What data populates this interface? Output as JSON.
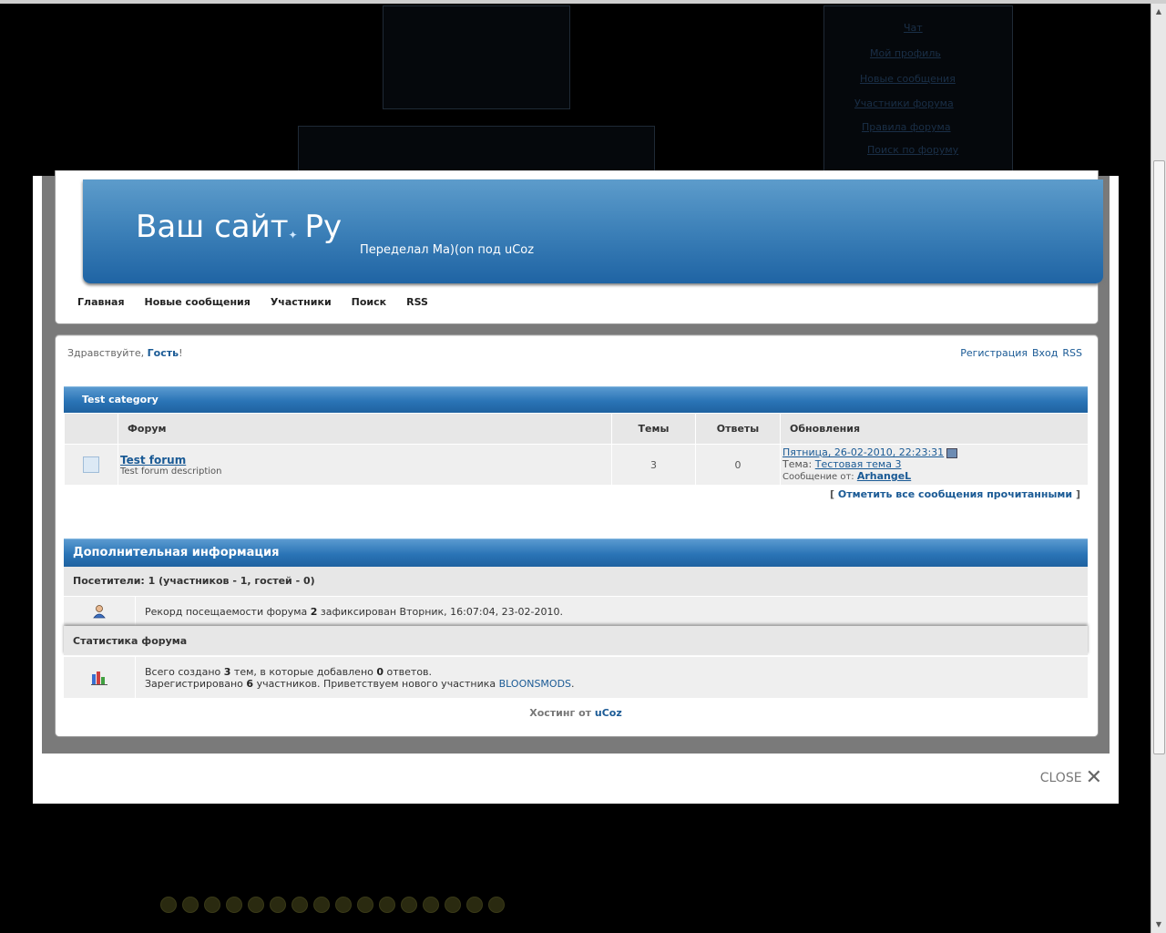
{
  "background": {
    "links": [
      "Чат",
      "Мой профиль",
      "Новые сообщения",
      "Участники форума",
      "Правила форума",
      "Поиск по форуму"
    ]
  },
  "site": {
    "title_part1": "Ваш сайт",
    "title_part2": "Ру",
    "slogan": "Переделал Ma)(on под uCoz"
  },
  "nav": [
    "Главная",
    "Новые сообщения",
    "Участники",
    "Поиск",
    "RSS"
  ],
  "greeting": {
    "prefix": "Здравствуйте,",
    "user": "Гость",
    "suffix": "!"
  },
  "top_links": [
    "Регистрация",
    "Вход",
    "RSS"
  ],
  "category": {
    "title": "Test category",
    "columns": [
      "Форум",
      "Темы",
      "Ответы",
      "Обновления"
    ],
    "forums": [
      {
        "name": "Test forum",
        "description": "Test forum description",
        "topics": "3",
        "replies": "0",
        "last_date": "Пятница, 26-02-2010, 22:23:31",
        "topic_label": "Тема:",
        "topic_title": "Тестовая тема 3",
        "author_label": "Сообщение от:",
        "author": "ArhangeL"
      }
    ]
  },
  "mark_read": {
    "open": "[",
    "label": "Отметить все сообщения прочитанными",
    "close": "]"
  },
  "info": {
    "title": "Дополнительная информация",
    "visitors_header": "Посетители: 1  (участников - 1, гостей - 0)",
    "record_pre": "Рекорд посещаемости форума",
    "record_num": "2",
    "record_post": "зафиксирован Вторник, 16:07:04, 23-02-2010.",
    "stats_header": "Статистика форума",
    "stats_l1_pre": "Всего создано",
    "stats_l1_topics": "3",
    "stats_l1_mid": "тем, в которые добавлено",
    "stats_l1_replies": "0",
    "stats_l1_post": "ответов.",
    "stats_l2_pre": "Зарегистрировано",
    "stats_l2_num": "6",
    "stats_l2_mid": "участников. Приветствуем нового участника",
    "stats_l2_user": "BLOONSMODS",
    "stats_l2_post": "."
  },
  "footer": {
    "label": "Хостинг от",
    "link": "uCoz"
  },
  "close_label": "CLOSE"
}
